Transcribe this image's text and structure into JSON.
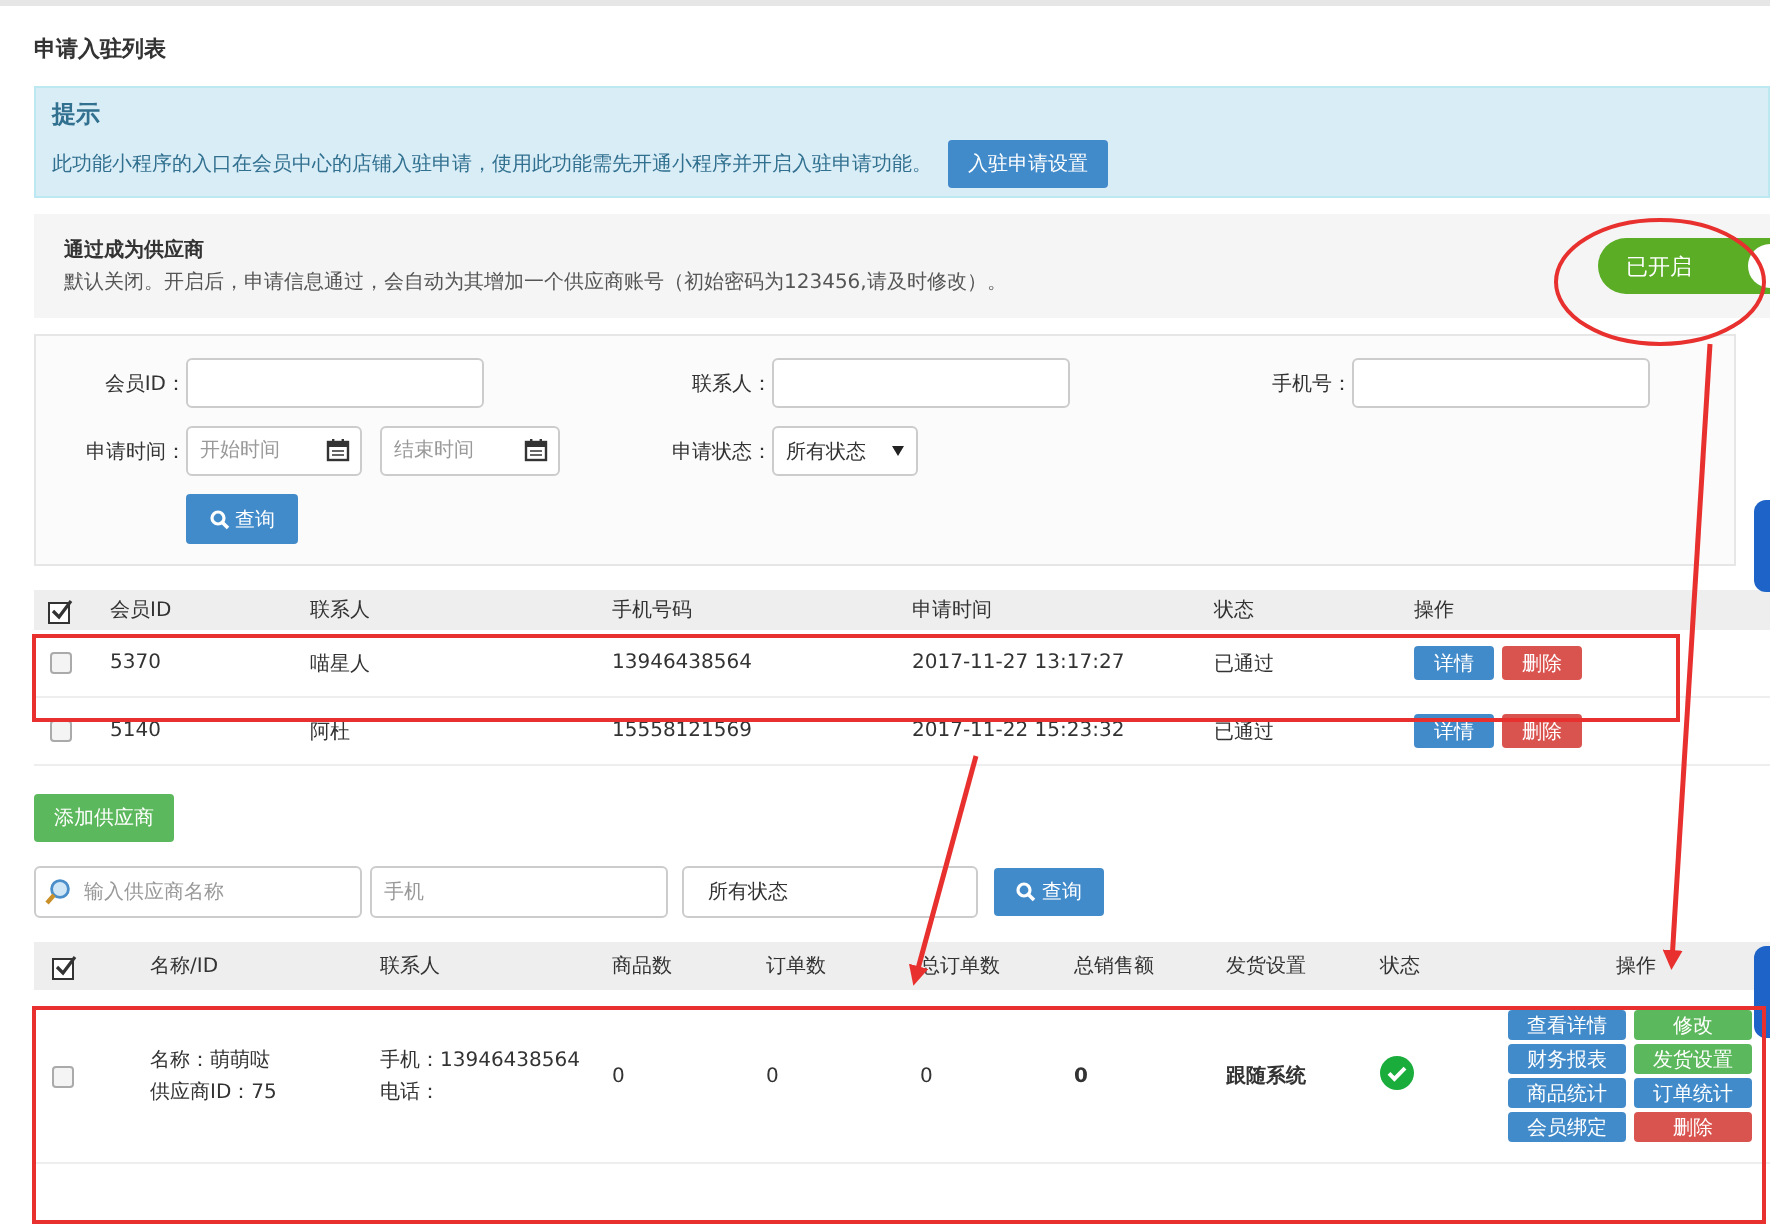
{
  "page_title": "申请入驻列表",
  "notice": {
    "title": "提示",
    "text": "此功能小程序的入口在会员中心的店铺入驻申请，使用此功能需先开通小程序并开启入驻申请功能。",
    "button": "入驻申请设置"
  },
  "supplier_toggle": {
    "title": "通过成为供应商",
    "description": "默认关闭。开启后，申请信息通过，会自动为其增加一个供应商账号（初始密码为123456,请及时修改）。",
    "on": true,
    "label": "已开启"
  },
  "filter": {
    "member_id": {
      "label": "会员ID："
    },
    "contact": {
      "label": "联系人："
    },
    "phone": {
      "label": "手机号："
    },
    "apply_time": {
      "label": "申请时间：",
      "start_placeholder": "开始时间",
      "end_placeholder": "结束时间"
    },
    "status": {
      "label": "申请状态：",
      "value": "所有状态"
    },
    "search_button": "查询"
  },
  "applications": {
    "columns": [
      "会员ID",
      "联系人",
      "手机号码",
      "申请时间",
      "状态",
      "操作"
    ],
    "rows": [
      {
        "checked": false,
        "member_id": "5370",
        "contact": "喵星人",
        "phone": "13946438564",
        "time": "2017-11-27 13:17:27",
        "status": "已通过",
        "actions": [
          {
            "label": "详情",
            "kind": "primary"
          },
          {
            "label": "删除",
            "kind": "danger"
          }
        ]
      },
      {
        "checked": false,
        "member_id": "5140",
        "contact": "阿杜",
        "phone": "15558121569",
        "time": "2017-11-22 15:23:32",
        "status": "已通过",
        "actions": [
          {
            "label": "详情",
            "kind": "primary"
          },
          {
            "label": "删除",
            "kind": "danger"
          }
        ]
      }
    ]
  },
  "add_supplier_button": "添加供应商",
  "supplier_search": {
    "name_placeholder": "输入供应商名称",
    "phone_placeholder": "手机",
    "status_value": "所有状态",
    "button": "查询"
  },
  "suppliers": {
    "columns": [
      "名称/ID",
      "联系人",
      "商品数",
      "订单数",
      "总订单数",
      "总销售额",
      "发货设置",
      "状态",
      "操作"
    ],
    "rows": [
      {
        "checked": false,
        "name": "名称：萌萌哒",
        "supplier_id": "供应商ID：75",
        "mobile": "手机：13946438564",
        "tel": "电话：",
        "products": "0",
        "orders": "0",
        "total_orders": "0",
        "total_sales": "0",
        "shipping": "跟随系统",
        "enabled": true,
        "actions": [
          {
            "label": "查看详情",
            "kind": "primary"
          },
          {
            "label": "修改",
            "kind": "success"
          },
          {
            "label": "财务报表",
            "kind": "primary"
          },
          {
            "label": "发货设置",
            "kind": "success"
          },
          {
            "label": "商品统计",
            "kind": "primary"
          },
          {
            "label": "订单统计",
            "kind": "primary"
          },
          {
            "label": "会员绑定",
            "kind": "primary"
          },
          {
            "label": "删除",
            "kind": "danger"
          }
        ]
      }
    ]
  }
}
